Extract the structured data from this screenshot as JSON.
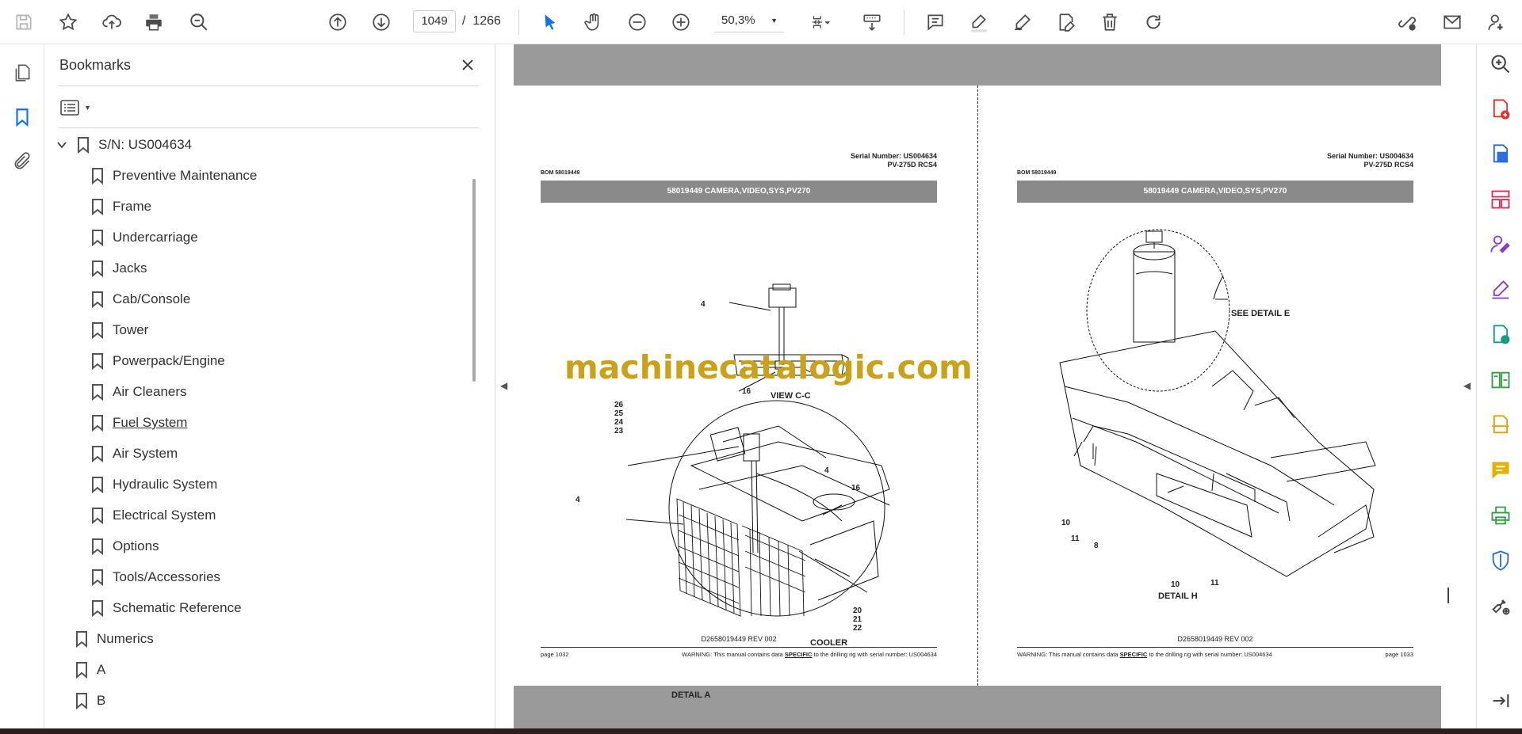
{
  "toolbar": {
    "current_page": "1049",
    "page_separator": "/",
    "total_pages": "1266",
    "zoom": "50,3%"
  },
  "bookmarks_panel": {
    "title": "Bookmarks",
    "root": "S/N: US004634",
    "children": [
      "Preventive Maintenance",
      "Frame",
      "Undercarriage",
      "Jacks",
      "Cab/Console",
      "Tower",
      "Powerpack/Engine",
      "Air Cleaners",
      "Fuel System",
      "Air System",
      "Hydraulic System",
      "Electrical System",
      "Options",
      "Tools/Accessories",
      "Schematic Reference"
    ],
    "top_level": [
      "Numerics",
      "A",
      "B"
    ]
  },
  "pages": [
    {
      "serial_line1": "Serial Number: US004634",
      "serial_line2": "PV-275D RCS4",
      "bom": "BOM 58019449",
      "header_bar": "58019449 CAMERA,VIDEO,SYS,PV270",
      "doc_number": "D2658019449 REV 002",
      "page_label": "page 1032",
      "warning_pre": "WARNING:  This manual contains data ",
      "warning_em": "SPECIFIC",
      "warning_post": " to the drilling rig with serial number: US004634",
      "labels": {
        "view": "VIEW C-C",
        "detail": "DETAIL  A",
        "cooler": "COOLER",
        "n4a": "4",
        "n16a": "16",
        "n26": "26",
        "n25": "25",
        "n24": "24",
        "n23": "23",
        "n4b": "4",
        "n16b": "16",
        "n4c": "4",
        "n20": "20",
        "n21": "21",
        "n22": "22"
      }
    },
    {
      "serial_line1": "Serial Number: US004634",
      "serial_line2": "PV-275D RCS4",
      "bom": "BOM 58019449",
      "header_bar": "58019449 CAMERA,VIDEO,SYS,PV270",
      "doc_number": "D2658019449 REV 002",
      "page_label": "page 1033",
      "warning_pre": "WARNING:  This manual contains data ",
      "warning_em": "SPECIFIC",
      "warning_post": " to the drilling rig with serial number: US004634",
      "labels": {
        "see_detail": "SEE DETAIL  E",
        "detail": "DETAIL  H",
        "n10a": "10",
        "n11a": "11",
        "n8": "8",
        "n10b": "10",
        "n11b": "11"
      }
    }
  ],
  "watermark": "machinecatalogic.com",
  "icons": {
    "toolbar": [
      "save-icon",
      "star-icon",
      "upload-icon",
      "print-icon",
      "zoom-search-icon",
      "page-up-icon",
      "page-down-icon",
      "zoom-out-icon",
      "zoom-in-icon",
      "select-arrow-icon",
      "hand-icon",
      "fit-page-icon",
      "scroll-mode-icon",
      "comment-icon",
      "highlight-icon",
      "draw-icon",
      "edit-icon",
      "delete-icon",
      "rotate-icon",
      "share-link-icon",
      "mail-icon",
      "account-icon"
    ],
    "right_rail": [
      "zoom-icon",
      "create-pdf-icon",
      "export-pdf-icon",
      "organize-pages-icon",
      "request-signature-icon",
      "fill-sign-icon",
      "send-review-icon",
      "compare-icon",
      "scan-icon",
      "comment-icon",
      "print-production-icon",
      "protect-icon",
      "more-tools-icon",
      "collapse-rail-icon"
    ]
  },
  "colors": {
    "accent_blue": "#1473e6",
    "watermark": "#c9a21a",
    "viewer_bg": "#9a9a9a"
  }
}
